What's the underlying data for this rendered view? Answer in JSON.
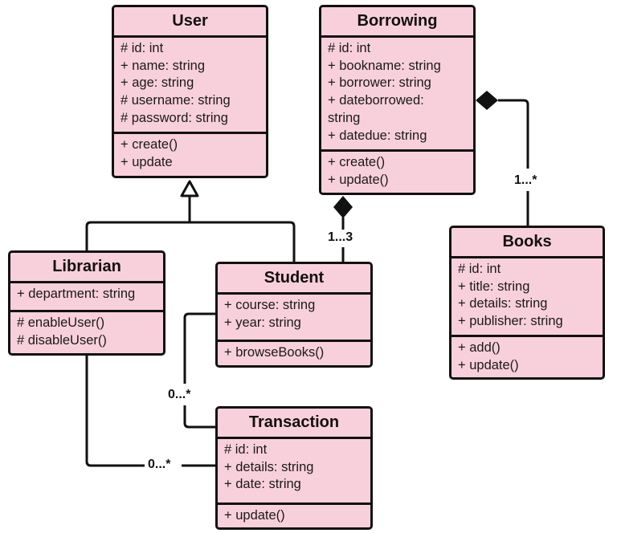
{
  "diagram": {
    "type": "UML class diagram",
    "colors": {
      "class_fill": "#f8d0dc",
      "stroke": "#111111"
    },
    "classes": {
      "user": {
        "name": "User",
        "attributes": [
          "# id: int",
          "+ name: string",
          "+ age: string",
          "# username: string",
          "# password: string"
        ],
        "methods": [
          "+ create()",
          "+ update"
        ]
      },
      "borrowing": {
        "name": "Borrowing",
        "attributes": [
          "# id: int",
          "+ bookname: string",
          "+ borrower: string",
          "+ dateborrowed:",
          "string",
          "+ datedue: string"
        ],
        "methods": [
          "+ create()",
          "+ update()"
        ]
      },
      "librarian": {
        "name": "Librarian",
        "attributes": [
          "+ department: string"
        ],
        "methods": [
          "# enableUser()",
          "# disableUser()"
        ]
      },
      "student": {
        "name": "Student",
        "attributes": [
          "+ course: string",
          "+ year: string"
        ],
        "methods": [
          "+ browseBooks()"
        ]
      },
      "books": {
        "name": "Books",
        "attributes": [
          "# id: int",
          "+ title: string",
          "+ details: string",
          "+ publisher: string"
        ],
        "methods": [
          "+ add()",
          "+ update()"
        ]
      },
      "transaction": {
        "name": "Transaction",
        "attributes": [
          "# id: int",
          "+ details: string",
          "+ date: string"
        ],
        "methods": [
          "+ update()"
        ]
      }
    },
    "relationships": [
      {
        "kind": "generalization",
        "from": "Librarian",
        "to": "User"
      },
      {
        "kind": "generalization",
        "from": "Student",
        "to": "User"
      },
      {
        "kind": "composition",
        "whole": "Borrowing",
        "part": "Student",
        "multiplicity": "1...3"
      },
      {
        "kind": "composition",
        "whole": "Borrowing",
        "part": "Books",
        "multiplicity": "1...*"
      },
      {
        "kind": "association",
        "from": "Student",
        "to": "Transaction",
        "multiplicity": "0...*"
      },
      {
        "kind": "association",
        "from": "Librarian",
        "to": "Transaction",
        "multiplicity": "0...*"
      }
    ],
    "multiplicities": {
      "borrowing_student": "1...3",
      "borrowing_books": "1...*",
      "student_transaction": "0...*",
      "librarian_transaction": "0...*"
    }
  }
}
